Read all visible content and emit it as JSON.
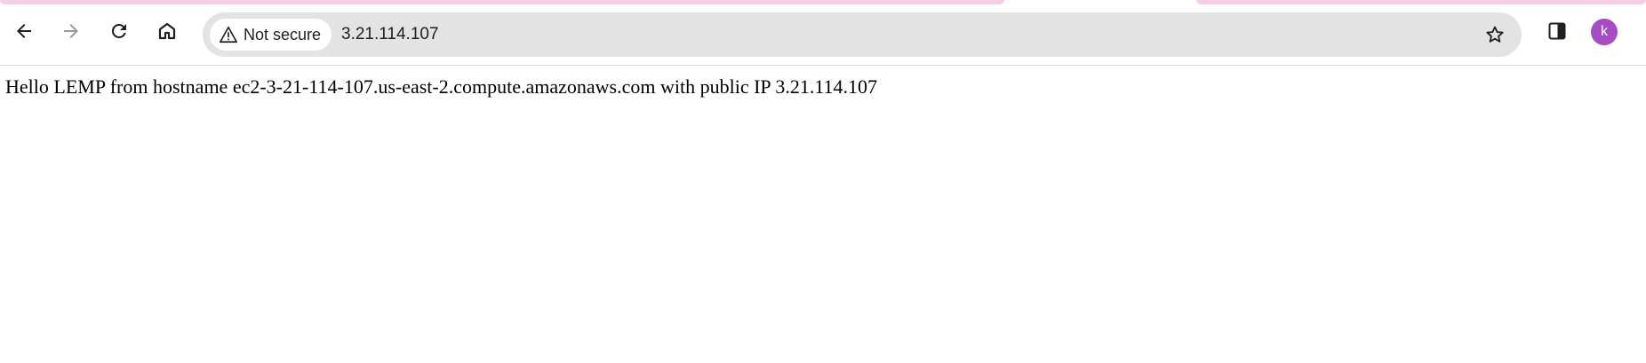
{
  "browser": {
    "security_label": "Not secure",
    "url": "3.21.114.107",
    "profile_initial": "k",
    "colors": {
      "tab_accent": "#f2cfe3",
      "omnibox_bg": "#e3e3e3",
      "avatar_bg": "#a64dc4"
    },
    "icons": [
      "back-arrow-icon",
      "forward-arrow-icon",
      "reload-icon",
      "home-icon",
      "warning-icon",
      "star-icon",
      "side-panel-icon"
    ]
  },
  "page": {
    "text": "Hello LEMP from hostname ec2-3-21-114-107.us-east-2.compute.amazonaws.com with public IP 3.21.114.107"
  }
}
